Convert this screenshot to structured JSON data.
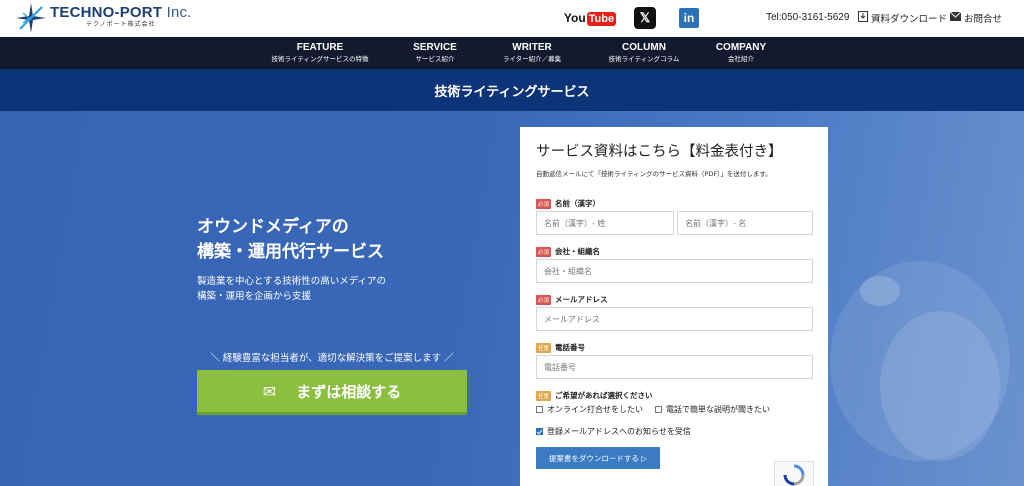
{
  "header": {
    "logo_name": "TECHNO-PORT",
    "logo_inc": " Inc.",
    "logo_sub": "テクノポート株式会社",
    "youtube_text": "You",
    "youtube_box": "Tube",
    "x_glyph": "𝕏",
    "linkedin_text": "in",
    "tel": "Tel:050-3161-5629",
    "download_label": "資料ダウンロード",
    "contact_label": "お問合せ",
    "icons": {
      "download": "download-icon",
      "contact": "mail-icon"
    }
  },
  "nav": {
    "items": [
      {
        "en": "FEATURE",
        "ja": "技術ライティングサービスの特徴"
      },
      {
        "en": "SERVICE",
        "ja": "サービス紹介"
      },
      {
        "en": "WRITER",
        "ja": "ライター紹介／募集"
      },
      {
        "en": "COLUMN",
        "ja": "技術ライティングコラム"
      },
      {
        "en": "COMPANY",
        "ja": "会社紹介"
      }
    ]
  },
  "title_bar": "技術ライティングサービス",
  "hero": {
    "heading_line1": "オウンドメディアの",
    "heading_line2": "構築・運用代行サービス",
    "desc_line1": "製造業を中心とする技術性の高いメディアの",
    "desc_line2": "構築・運用を企画から支援",
    "note": "＼ 経験豊富な担当者が、適切な解決策をご提案します ／",
    "cta_label": "まずは相談する",
    "cta_icon": "✉"
  },
  "form": {
    "title": "サービス資料はこちら【料金表付き】",
    "subtitle": "自動返信メールにて「技術ライティングのサービス資料（PDF）」を送付します。",
    "required_badge": "必須",
    "optional_badge": "任意",
    "name_label": "名前（漢字）",
    "last_name_placeholder": "名前（漢字）- 姓",
    "first_name_placeholder": "名前（漢字）- 名",
    "company_label": "会社・組織名",
    "company_placeholder": "会社・組織名",
    "email_label": "メールアドレス",
    "email_placeholder": "メールアドレス",
    "phone_label": "電話番号",
    "phone_placeholder": "電話番号",
    "options_label": "ご希望があれば選択ください",
    "option_online": "オンライン打合せをしたい",
    "option_phone": "電話で簡単な説明が聞きたい",
    "newsletter_label": "登録メールアドレスへのお知らせを受信",
    "submit_label": "提案書をダウンロードする ▷"
  },
  "colors": {
    "nav_bg": "#121a2e",
    "title_bar_bg": "#0d3478",
    "hero_bg": "#3764b4",
    "cta_bg": "#8bbf3f",
    "submit_bg": "#3a7bc4"
  }
}
